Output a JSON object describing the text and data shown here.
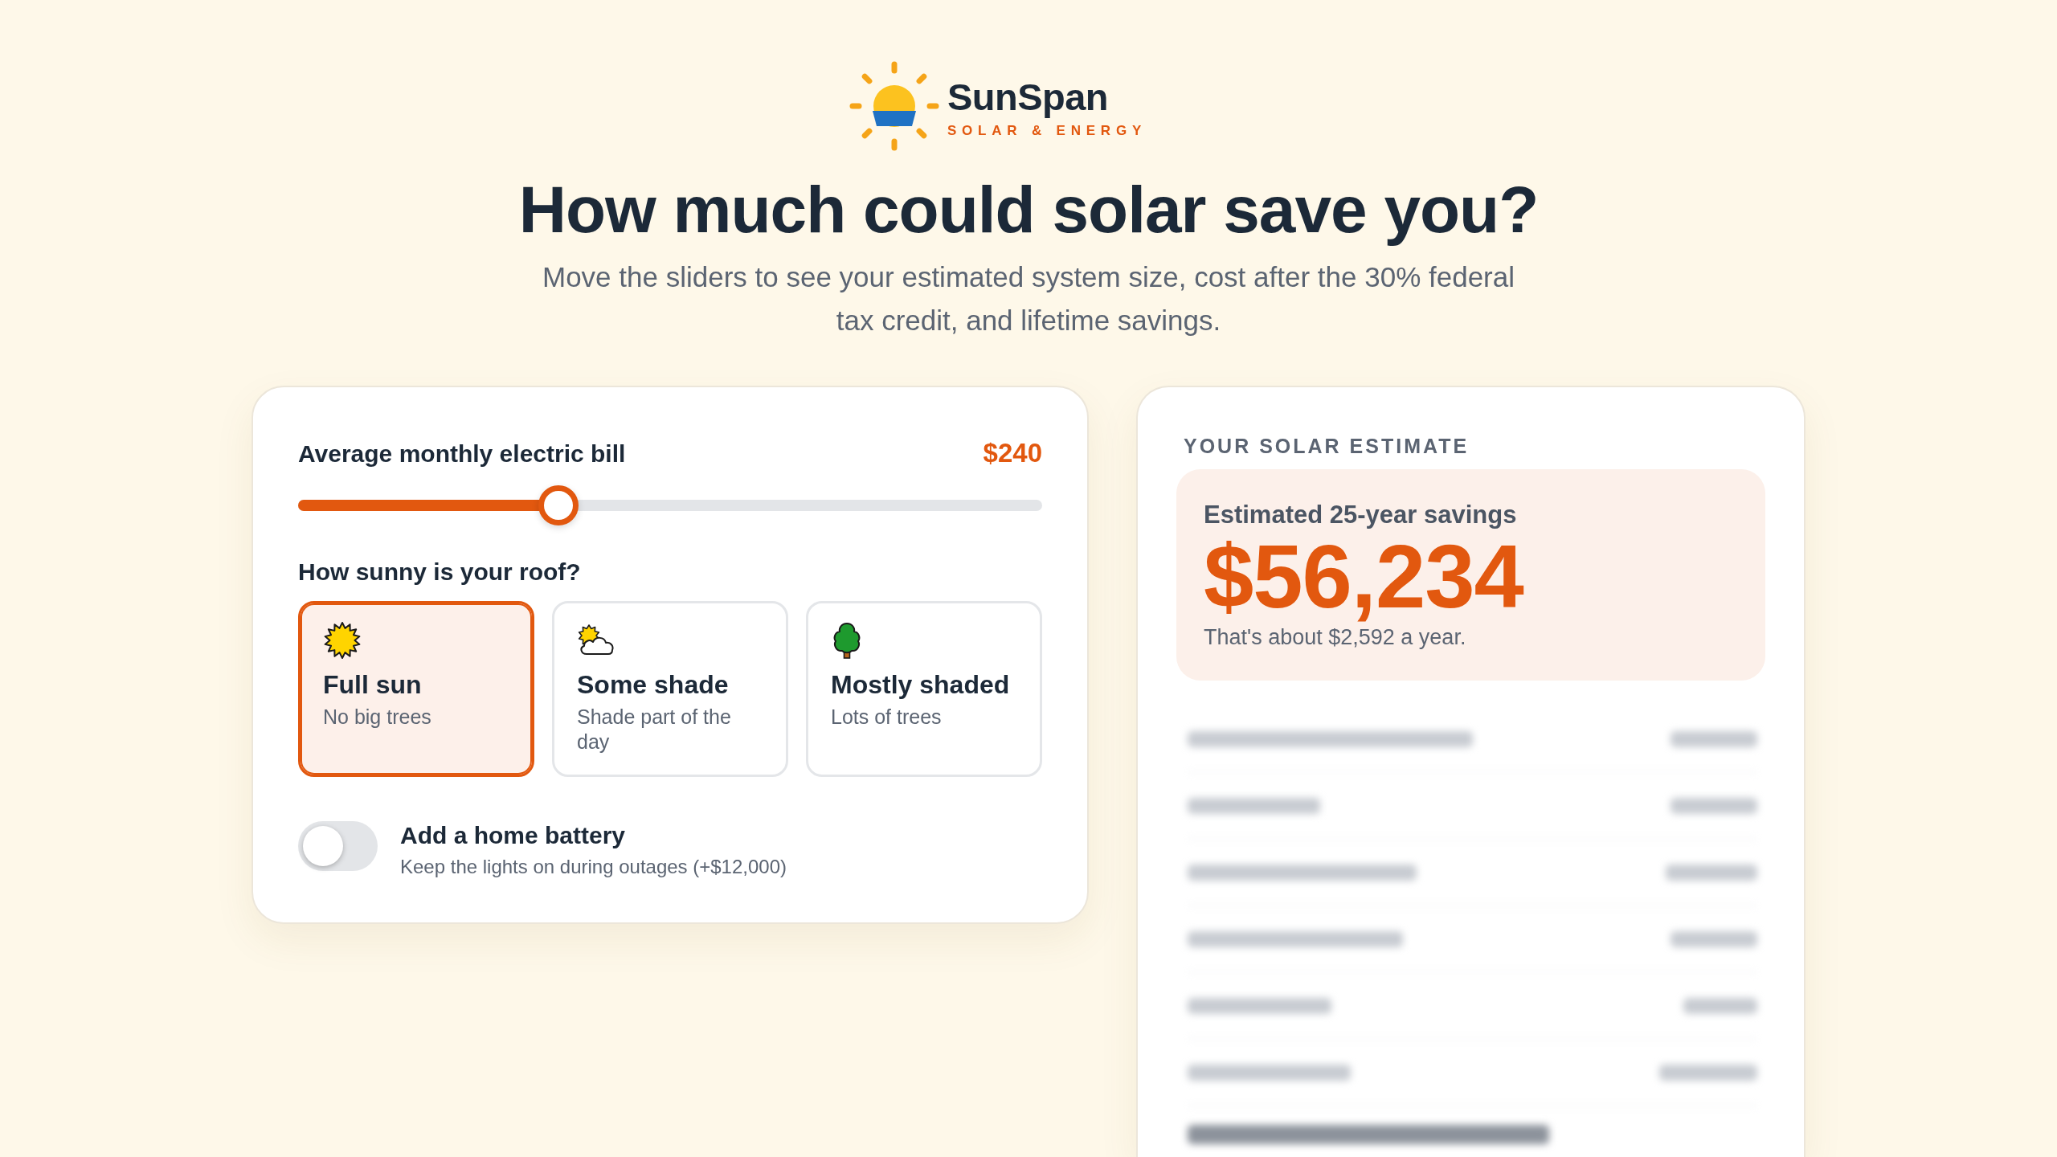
{
  "brand": {
    "name": "SunSpan",
    "tagline": "SOLAR & ENERGY"
  },
  "hero": {
    "title": "How much could solar save you?",
    "subtitle": "Move the sliders to see your estimated system size, cost after the 30% federal tax credit, and lifetime savings."
  },
  "calculator": {
    "bill": {
      "label": "Average monthly electric bill",
      "reading": "$240",
      "level": 0.35
    },
    "roof": {
      "label": "How sunny is your roof?",
      "options": [
        {
          "kind": "sun",
          "title": "Full sun",
          "note": "No big trees",
          "selected": true
        },
        {
          "kind": "cloud",
          "title": "Some shade",
          "note": "Shade part of the day",
          "selected": false
        },
        {
          "kind": "tree",
          "title": "Mostly shaded",
          "note": "Lots of trees",
          "selected": false
        }
      ]
    },
    "battery": {
      "label": "Add a home battery",
      "note": "Keep the lights on during outages (+$12,000)",
      "on": false
    }
  },
  "estimate": {
    "heading": "YOUR SOLAR ESTIMATE",
    "savings": {
      "label": "Estimated 25-year savings",
      "amount": "$56,234",
      "note": "That's about $2,592 a year."
    }
  }
}
